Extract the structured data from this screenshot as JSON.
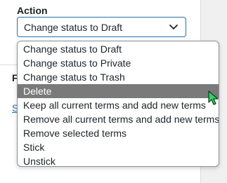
{
  "action": {
    "label": "Action",
    "selected_value": "Change status to Draft",
    "options": [
      "Change status to Draft",
      "Change status to Private",
      "Change status to Trash",
      "Delete",
      "Keep all current terms and add new terms",
      "Remove all current terms and add new terms",
      "Remove selected terms",
      "Stick",
      "Unstick"
    ],
    "highlighted_option": "Delete"
  },
  "background_panel": {
    "partial_heading": "F",
    "partial_link": "S"
  },
  "colors": {
    "accent": "#2271b1",
    "highlight": "#7a7a7a",
    "cursor": "#2fd066"
  },
  "icons": {
    "select_arrow": "chevron-down-icon",
    "pointer": "mouse-cursor-icon"
  }
}
